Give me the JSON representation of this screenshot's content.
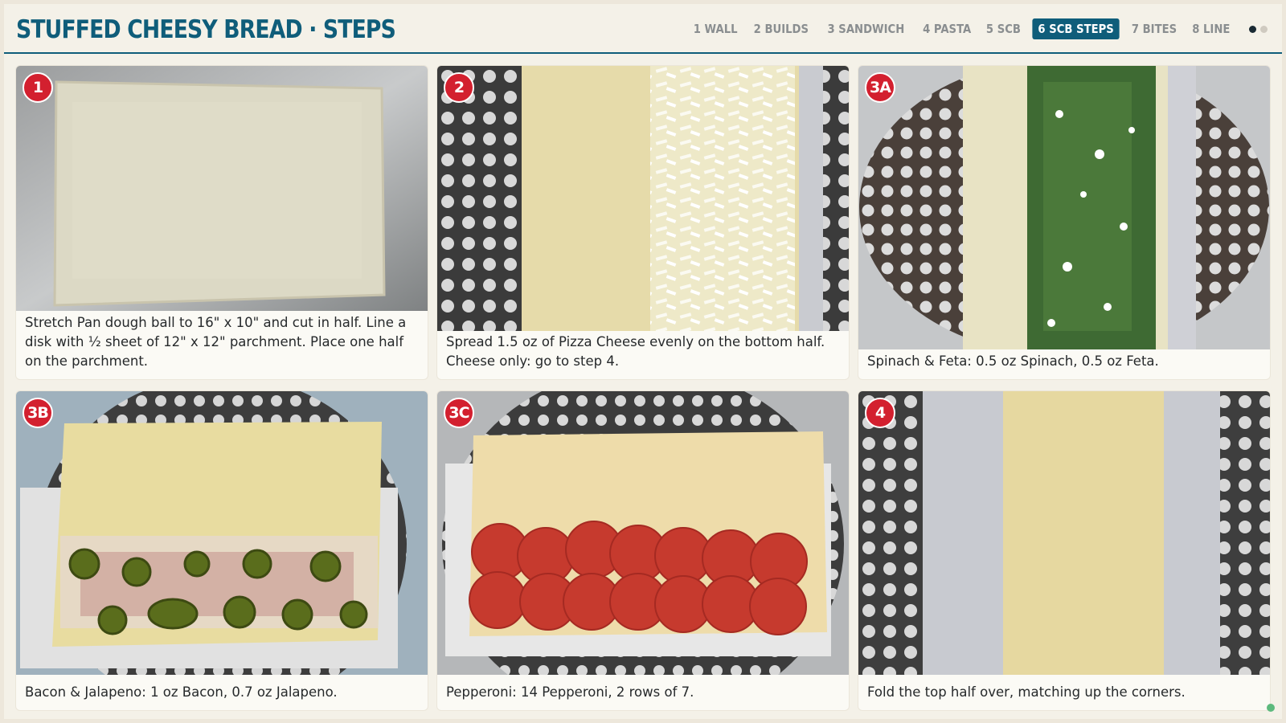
{
  "header": {
    "title": "STUFFED CHEESY BREAD · STEPS",
    "nav": [
      {
        "label": "1 WALL",
        "active": false
      },
      {
        "label": "2 BUILDS",
        "active": false
      },
      {
        "label": "3 SANDWICH",
        "active": false
      },
      {
        "label": "4 PASTA",
        "active": false
      },
      {
        "label": "5 SCB",
        "active": false
      },
      {
        "label": "6 SCB STEPS",
        "active": true
      },
      {
        "label": "7 BITES",
        "active": false
      },
      {
        "label": "8 LINE",
        "active": false
      }
    ]
  },
  "steps": [
    {
      "badge": "1",
      "caption": "Stretch Pan dough ball to 16\" x 10\" and cut in half. Line a disk with ½ sheet of 12\" x 12\" parchment. Place one half on the parchment."
    },
    {
      "badge": "2",
      "caption": "Spread 1.5 oz of Pizza Cheese evenly on the bottom half. Cheese only: go to step 4."
    },
    {
      "badge": "3A",
      "caption": "Spinach & Feta: 0.5 oz Spinach, 0.5 oz Feta."
    },
    {
      "badge": "3B",
      "caption": "Bacon & Jalapeno: 1 oz Bacon, 0.7 oz Jalapeno."
    },
    {
      "badge": "3C",
      "caption": "Pepperoni: 14 Pepperoni, 2 rows of 7."
    },
    {
      "badge": "4",
      "caption": "Fold the top half over, matching up the corners."
    }
  ],
  "colors": {
    "brand": "#0f5d7a",
    "badge": "#d3202f",
    "status": "#5cb97d"
  }
}
